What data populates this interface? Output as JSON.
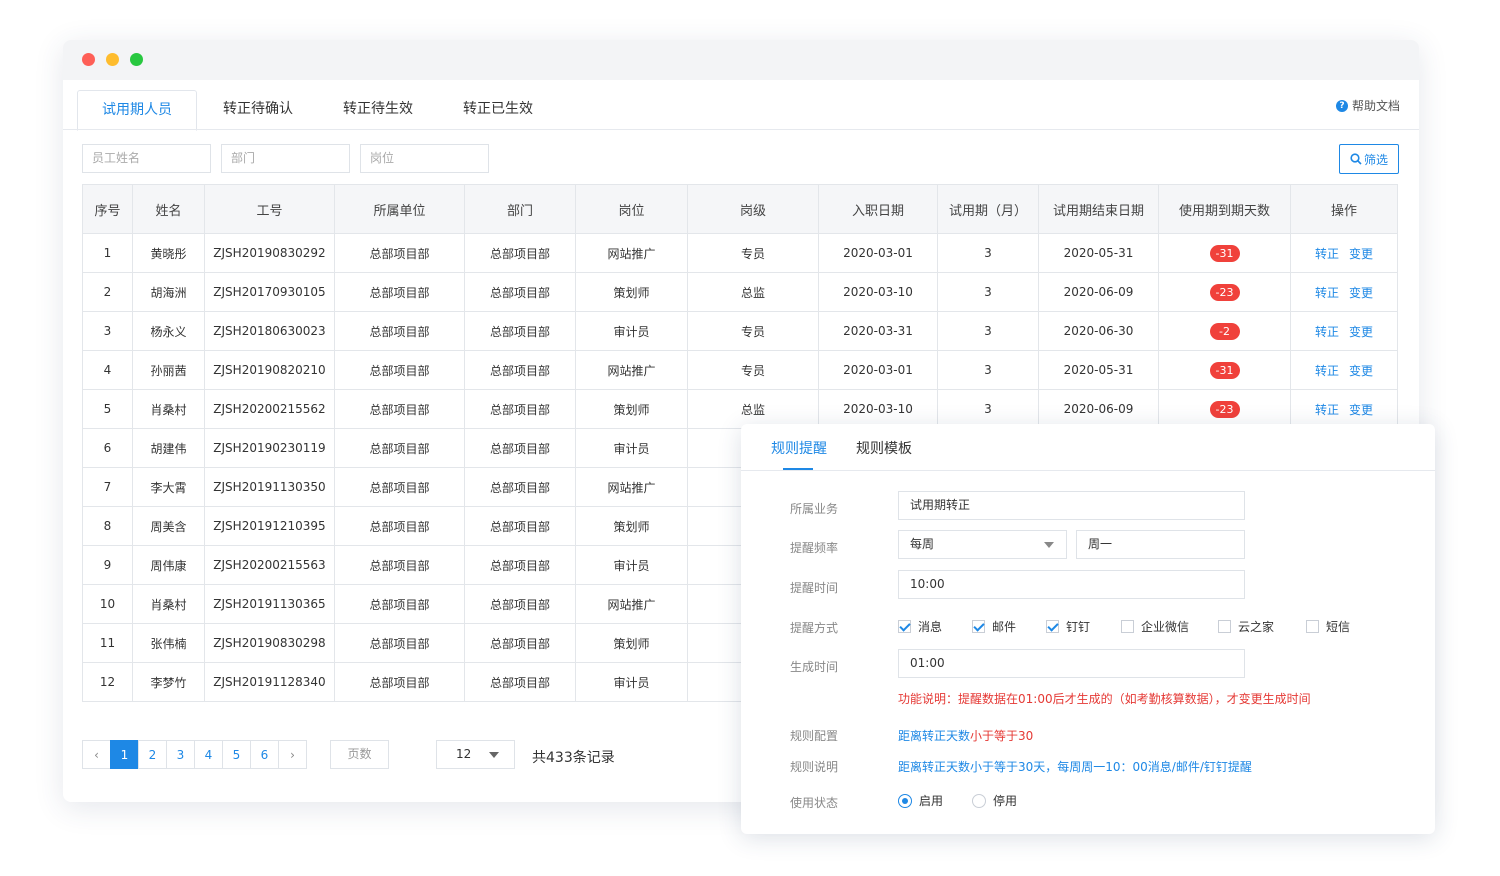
{
  "tabs": [
    "试用期人员",
    "转正待确认",
    "转正待生效",
    "转正已生效"
  ],
  "help": {
    "label": "帮助文档"
  },
  "filters": {
    "name": "员工姓名",
    "dept": "部门",
    "post": "岗位",
    "button": "筛选"
  },
  "table": {
    "headers": [
      "序号",
      "姓名",
      "工号",
      "所属单位",
      "部门",
      "岗位",
      "岗级",
      "入职日期",
      "试用期（月）",
      "试用期结束日期",
      "使用期到期天数",
      "操作"
    ],
    "rows": [
      {
        "no": "1",
        "name": "黄晓彤",
        "id": "ZJSH20190830292",
        "unit": "总部项目部",
        "dept": "总部项目部",
        "post": "网站推广",
        "level": "专员",
        "join": "2020-03-01",
        "months": "3",
        "end": "2020-05-31",
        "days": "-31"
      },
      {
        "no": "2",
        "name": "胡海洲",
        "id": "ZJSH20170930105",
        "unit": "总部项目部",
        "dept": "总部项目部",
        "post": "策划师",
        "level": "总监",
        "join": "2020-03-10",
        "months": "3",
        "end": "2020-06-09",
        "days": "-23"
      },
      {
        "no": "3",
        "name": "杨永义",
        "id": "ZJSH20180630023",
        "unit": "总部项目部",
        "dept": "总部项目部",
        "post": "审计员",
        "level": "专员",
        "join": "2020-03-31",
        "months": "3",
        "end": "2020-06-30",
        "days": "-2"
      },
      {
        "no": "4",
        "name": "孙丽茜",
        "id": "ZJSH20190820210",
        "unit": "总部项目部",
        "dept": "总部项目部",
        "post": "网站推广",
        "level": "专员",
        "join": "2020-03-01",
        "months": "3",
        "end": "2020-05-31",
        "days": "-31"
      },
      {
        "no": "5",
        "name": "肖桑村",
        "id": "ZJSH20200215562",
        "unit": "总部项目部",
        "dept": "总部项目部",
        "post": "策划师",
        "level": "总监",
        "join": "2020-03-10",
        "months": "3",
        "end": "2020-06-09",
        "days": "-23"
      },
      {
        "no": "6",
        "name": "胡建伟",
        "id": "ZJSH20190230119",
        "unit": "总部项目部",
        "dept": "总部项目部",
        "post": "审计员",
        "level": "",
        "join": "",
        "months": "",
        "end": "",
        "days": ""
      },
      {
        "no": "7",
        "name": "李大霄",
        "id": "ZJSH20191130350",
        "unit": "总部项目部",
        "dept": "总部项目部",
        "post": "网站推广",
        "level": "",
        "join": "",
        "months": "",
        "end": "",
        "days": ""
      },
      {
        "no": "8",
        "name": "周美含",
        "id": "ZJSH20191210395",
        "unit": "总部项目部",
        "dept": "总部项目部",
        "post": "策划师",
        "level": "",
        "join": "",
        "months": "",
        "end": "",
        "days": ""
      },
      {
        "no": "9",
        "name": "周伟康",
        "id": "ZJSH20200215563",
        "unit": "总部项目部",
        "dept": "总部项目部",
        "post": "审计员",
        "level": "",
        "join": "",
        "months": "",
        "end": "",
        "days": ""
      },
      {
        "no": "10",
        "name": "肖桑村",
        "id": "ZJSH20191130365",
        "unit": "总部项目部",
        "dept": "总部项目部",
        "post": "网站推广",
        "level": "",
        "join": "",
        "months": "",
        "end": "",
        "days": ""
      },
      {
        "no": "11",
        "name": "张伟楠",
        "id": "ZJSH20190830298",
        "unit": "总部项目部",
        "dept": "总部项目部",
        "post": "策划师",
        "level": "",
        "join": "",
        "months": "",
        "end": "",
        "days": ""
      },
      {
        "no": "12",
        "name": "李梦竹",
        "id": "ZJSH20191128340",
        "unit": "总部项目部",
        "dept": "总部项目部",
        "post": "审计员",
        "level": "",
        "join": "",
        "months": "",
        "end": "",
        "days": ""
      }
    ],
    "ops": [
      "转正",
      "变更"
    ]
  },
  "pager": {
    "prev": "‹",
    "next": "›",
    "pages": [
      "1",
      "2",
      "3",
      "4",
      "5",
      "6"
    ],
    "current": "1",
    "page_input": "页数",
    "page_size": "12",
    "total": "共433条记录"
  },
  "panel": {
    "tabs": [
      "规则提醒",
      "规则模板"
    ],
    "business_label": "所属业务",
    "business_value": "试用期转正",
    "freq_label": "提醒频率",
    "freq_value": "每周",
    "freq_day": "周一",
    "time_label": "提醒时间",
    "time_value": "10:00",
    "method_label": "提醒方式",
    "methods": [
      {
        "label": "消息",
        "checked": true
      },
      {
        "label": "邮件",
        "checked": true
      },
      {
        "label": "钉钉",
        "checked": true
      },
      {
        "label": "企业微信",
        "checked": false
      },
      {
        "label": "云之家",
        "checked": false
      },
      {
        "label": "短信",
        "checked": false
      }
    ],
    "gen_label": "生成时间",
    "gen_value": "01:00",
    "note": "功能说明：提醒数据在01:00后才生成的（如考勤核算数据），才变更生成时间",
    "config_label": "规则配置",
    "config_link": "距离转正天数",
    "config_cond": "小于等于30",
    "desc_label": "规则说明",
    "desc_value": "距离转正天数小于等于30天，每周周一10：00消息/邮件/钉钉提醒",
    "status_label": "使用状态",
    "status_on": "启用",
    "status_off": "停用"
  },
  "colors": {
    "accent": "#1e88e5",
    "danger": "#f0413b"
  }
}
